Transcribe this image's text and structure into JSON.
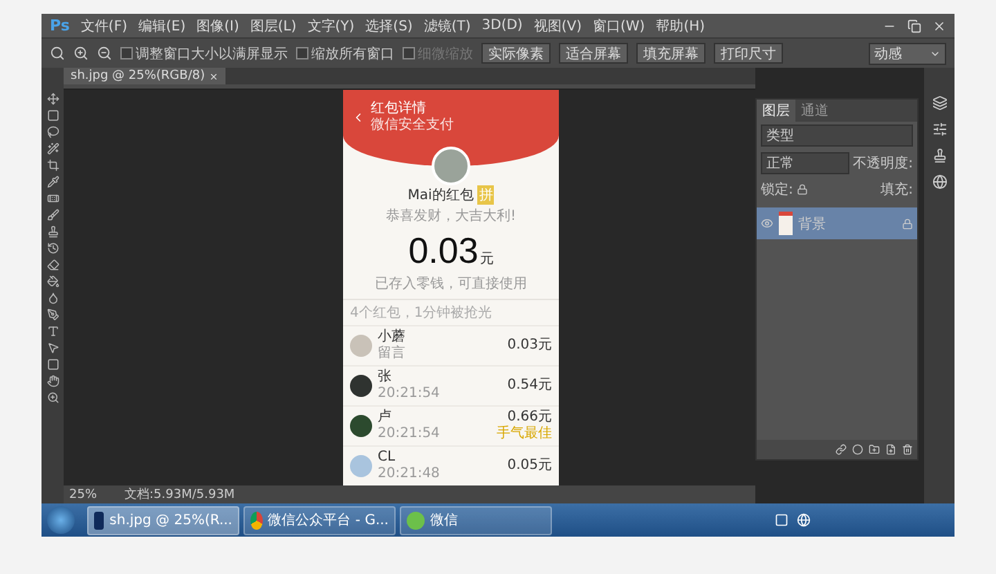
{
  "app": {
    "logo": "Ps",
    "menu": [
      "文件(F)",
      "编辑(E)",
      "图像(I)",
      "图层(L)",
      "文字(Y)",
      "选择(S)",
      "滤镜(T)",
      "3D(D)",
      "视图(V)",
      "窗口(W)",
      "帮助(H)"
    ]
  },
  "options_bar": {
    "checkboxes": [
      {
        "label": "调整窗口大小以满屏显示",
        "checked": false,
        "disabled": false
      },
      {
        "label": "缩放所有窗口",
        "checked": false,
        "disabled": false
      },
      {
        "label": "细微缩放",
        "checked": false,
        "disabled": true
      }
    ],
    "buttons": [
      "实际像素",
      "适合屏幕",
      "填充屏幕",
      "打印尺寸"
    ],
    "workspace": "动感"
  },
  "document_tab": {
    "title": "sh.jpg @ 25%(RGB/8)"
  },
  "phone": {
    "title": "红包详情",
    "subtitle": "微信安全支付",
    "sender": "Mai的红包",
    "sender_badge": "拼",
    "greeting": "恭喜发财，大吉大利!",
    "amount": "0.03",
    "unit": "元",
    "amount_note": "已存入零钱，可直接使用",
    "summary": "4个红包，1分钟被抢光",
    "entries": [
      {
        "name": "小蘑",
        "detail": "留言",
        "amount": "0.03元"
      },
      {
        "name": "张",
        "detail": "20:21:54",
        "amount": "0.54元"
      },
      {
        "name": "卢",
        "detail": "20:21:54",
        "amount": "0.66元",
        "badge": "手气最佳"
      },
      {
        "name": "CL",
        "detail": "20:21:48",
        "amount": "0.05元"
      }
    ]
  },
  "layers_panel": {
    "tabs": [
      {
        "label": "图层",
        "selected": true
      },
      {
        "label": "通道",
        "selected": false
      }
    ],
    "filter": "类型",
    "blend_mode": "正常",
    "opacity_label": "不透明度:",
    "lock_label": "锁定:",
    "fill_label": "填充:",
    "layers": [
      {
        "name": "背景",
        "visible": true,
        "selected": true
      }
    ]
  },
  "status_bar": {
    "zoom": "25%",
    "document": "文档:5.93M/5.93M"
  },
  "taskbar": {
    "items": [
      {
        "kind": "photoshop",
        "label": "sh.jpg @ 25%(R...",
        "selected": true
      },
      {
        "kind": "chrome",
        "label": "微信公众平台 - G...",
        "selected": false
      },
      {
        "kind": "wechat",
        "label": "微信",
        "selected": false
      }
    ]
  }
}
